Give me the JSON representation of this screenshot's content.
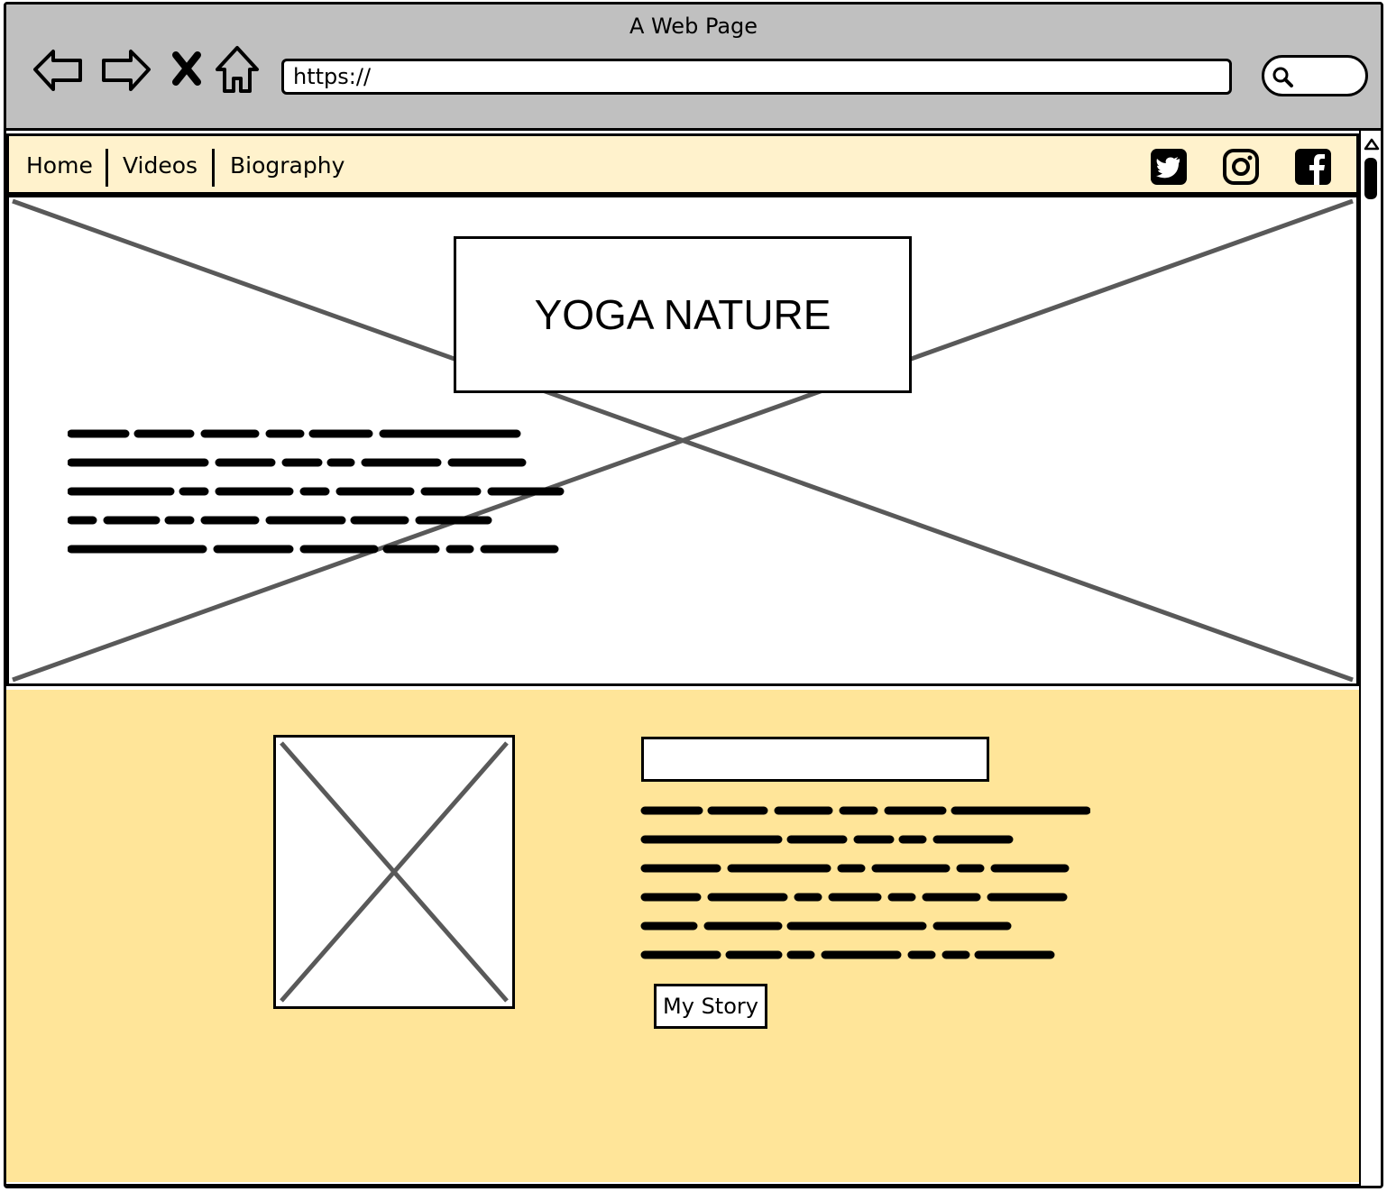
{
  "browser": {
    "title": "A Web Page",
    "url": "https://"
  },
  "navbar": {
    "links": [
      "Home",
      "Videos",
      "Biography"
    ]
  },
  "hero": {
    "title": "YOGA NATURE"
  },
  "about": {
    "button_label": "My Story"
  },
  "colors": {
    "chrome": "#c0c0c0",
    "navbar_bg": "#fff2cc",
    "about_bg": "#ffe599"
  },
  "icons": [
    "back-icon",
    "forward-icon",
    "close-icon",
    "home-icon",
    "search-icon",
    "twitter-icon",
    "instagram-icon",
    "facebook-icon"
  ]
}
